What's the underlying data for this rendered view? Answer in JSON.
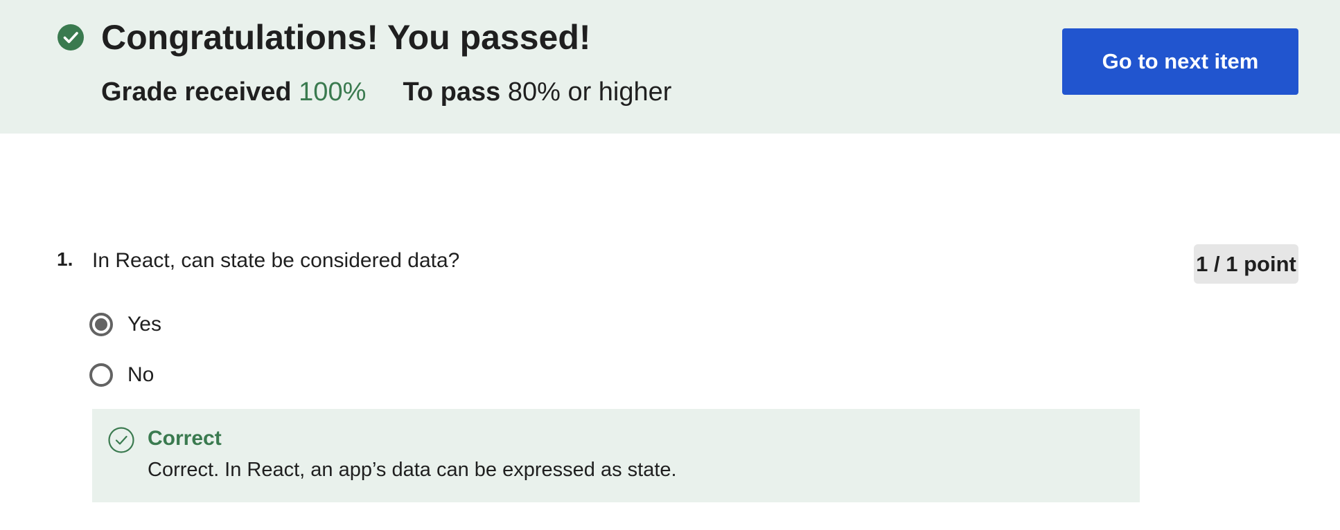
{
  "banner": {
    "title": "Congratulations! You passed!",
    "grade_label": "Grade received",
    "grade_value": "100%",
    "pass_label": "To pass",
    "pass_value": "80% or higher",
    "next_button_label": "Go to next item",
    "icon": "check-circle-filled-icon"
  },
  "question": {
    "number": "1.",
    "text": "In React, can state be considered data?",
    "points": "1 / 1 point",
    "options": [
      {
        "label": "Yes",
        "selected": true
      },
      {
        "label": "No",
        "selected": false
      }
    ],
    "feedback": {
      "icon": "check-circle-outline-icon",
      "title": "Correct",
      "text": "Correct. In React, an app’s data can be expressed as state."
    }
  },
  "colors": {
    "banner_bg": "#e9f1ec",
    "success_green": "#3a7a4f",
    "primary_button": "#2155cf",
    "badge_bg": "#e6e6e6"
  }
}
